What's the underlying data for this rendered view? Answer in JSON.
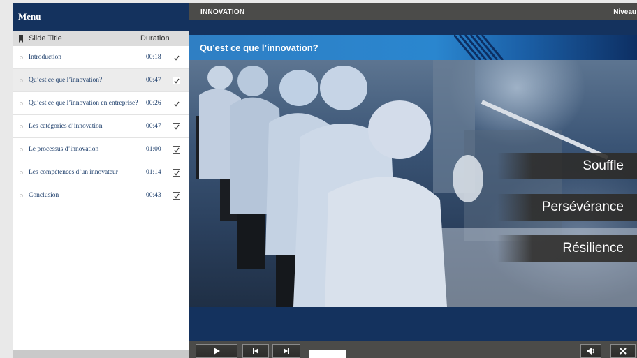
{
  "menu": {
    "title": "Menu",
    "col_title": "Slide Title",
    "col_duration": "Duration",
    "active_index": 1,
    "slides": [
      {
        "title": "Introduction",
        "duration": "00:18",
        "checked": true
      },
      {
        "title": "Qu’est ce que l’innovation?",
        "duration": "00:47",
        "checked": true
      },
      {
        "title": "Qu’est ce que l’innovation en entreprise?",
        "duration": "00:26",
        "checked": true
      },
      {
        "title": "Les catégories d’innovation",
        "duration": "00:47",
        "checked": true
      },
      {
        "title": "Le processus d’innovation",
        "duration": "01:00",
        "checked": true
      },
      {
        "title": "Les compétences d’un innovateur",
        "duration": "01:14",
        "checked": true
      },
      {
        "title": "Conclusion",
        "duration": "00:43",
        "checked": true
      }
    ]
  },
  "player": {
    "course_title": "INNOVATION",
    "level_label": "Niveau",
    "slide_title": "Qu’est ce que l’innovation?",
    "keywords": [
      "Souffle",
      "Persévérance",
      "Résilience"
    ],
    "controls": {
      "play_icon": "play-icon",
      "prev_icon": "skip-previous-icon",
      "next_icon": "skip-next-icon",
      "volume_icon": "volume-icon",
      "close_icon": "close-icon"
    }
  },
  "colors": {
    "navy": "#14325e",
    "bar_gray": "#4b4b49",
    "accent_blue": "#2a86cf"
  }
}
